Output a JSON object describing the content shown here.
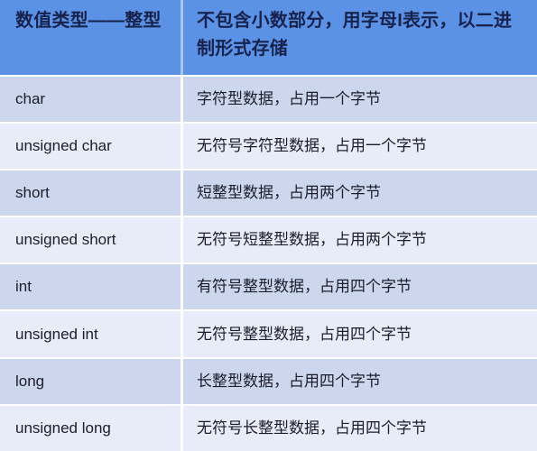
{
  "table": {
    "header": {
      "left": "数值类型——整型",
      "right": "不包含小数部分，用字母I表示，以二进制形式存储"
    },
    "columns": [
      "数值类型——整型",
      "不包含小数部分，用字母I表示，以二进制形式存储"
    ],
    "rows": [
      {
        "type": "char",
        "description": "字符型数据，占用一个字节"
      },
      {
        "type": "unsigned char",
        "description": "无符号字符型数据，占用一个字节"
      },
      {
        "type": "short",
        "description": "短整型数据，占用两个字节"
      },
      {
        "type": "unsigned short",
        "description": "无符号短整型数据，占用两个字节"
      },
      {
        "type": "int",
        "description": "有符号整型数据，占用四个字节"
      },
      {
        "type": "unsigned int",
        "description": "无符号整型数据，占用四个字节"
      },
      {
        "type": "long",
        "description": "长整型数据，占用四个字节"
      },
      {
        "type": "unsigned long",
        "description": "无符号长整型数据，占用四个字节"
      }
    ]
  },
  "colors": {
    "header_background": "#5b92e5",
    "header_text": "#17224d",
    "row_odd_background": "#ccd7ee",
    "row_even_background": "#e8ecf8",
    "row_text": "#1c1c2b",
    "divider": "#ffffff"
  }
}
